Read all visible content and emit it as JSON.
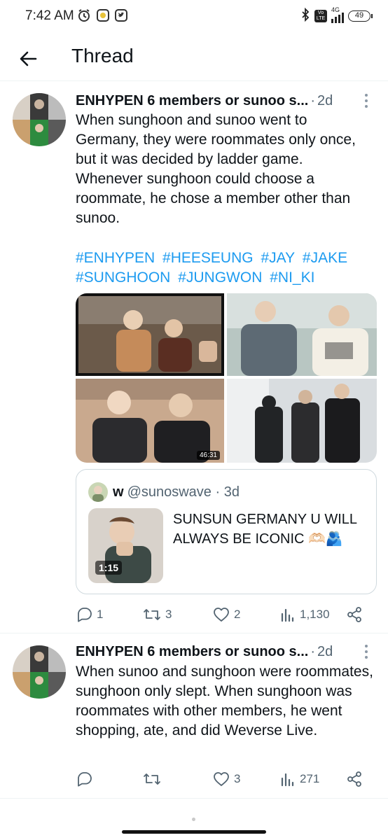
{
  "status_bar": {
    "time": "7:42 AM",
    "left_icons": [
      "alarm-icon",
      "app-notification-icon",
      "twitter-notification-icon"
    ],
    "right_icons": [
      "bluetooth-icon",
      "volte-icon",
      "signal-icon"
    ],
    "network": "4G",
    "lte_badge": "Vo LTE",
    "battery": "49"
  },
  "header": {
    "title": "Thread",
    "back_icon": "arrow-left-icon"
  },
  "tweets": [
    {
      "author": "ENHYPEN 6 members or sunoo s...",
      "time": "2d",
      "text": "When sunghoon and sunoo went to Germany, they were roommates only once, but it was decided by ladder game. Whenever sunghoon could choose a roommate, he chose a member other than sunoo.",
      "hashtags": [
        "#ENHYPEN",
        "#HEESEUNG",
        "#JAY",
        "#JAKE",
        "#SUNGHOON",
        "#JUNGWON",
        "#NI_KI"
      ],
      "media": [
        {
          "type": "video-still",
          "colors": [
            "#6b5a4a",
            "#c58b5a"
          ]
        },
        {
          "type": "photo",
          "colors": [
            "#b8c6c2",
            "#5d6a74"
          ]
        },
        {
          "type": "photo",
          "colors": [
            "#c9a98e",
            "#2b2b2e"
          ]
        },
        {
          "type": "photo",
          "colors": [
            "#d9dde0",
            "#222426"
          ]
        }
      ],
      "media_duration": "46:31",
      "quote": {
        "name": "w",
        "handle": "@sunoswave",
        "time": "3d",
        "text": "SUNSUN GERMANY U WILL ALWAYS BE ICONIC 🫶🏻🫂",
        "video_duration": "1:15"
      },
      "stats": {
        "replies": "1",
        "retweets": "3",
        "likes": "2",
        "views": "1,130"
      }
    },
    {
      "author": "ENHYPEN 6 members or sunoo s...",
      "time": "2d",
      "text": "When sunoo and sunghoon were roommates, sunghoon only slept. When sunghoon was roommates with other members, he went shopping, ate, and did Weverse Live.",
      "stats": {
        "replies": "",
        "retweets": "",
        "likes": "3",
        "views": "271"
      }
    }
  ],
  "colors": {
    "link": "#1d9bf0",
    "text": "#0f1419",
    "muted": "#536471",
    "border": "#cfd9de"
  }
}
